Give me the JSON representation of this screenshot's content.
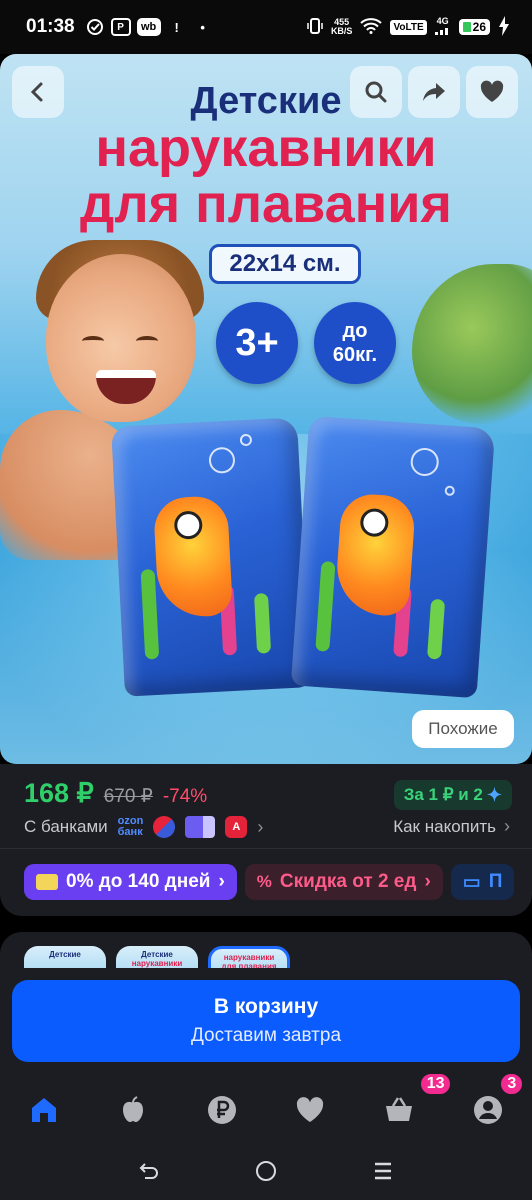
{
  "status_bar": {
    "time": "01:38",
    "net_speed_value": "455",
    "net_speed_unit": "KB/S",
    "volte": "VoLTE",
    "net_type": "4G",
    "battery": "26",
    "wb_label": "wb"
  },
  "hero": {
    "title_line1": "Детские",
    "title_line2": "нарукавники",
    "title_line3": "для плавания",
    "size_label": "22x14 см.",
    "age_badge": "3+",
    "weight_badge_line1": "до",
    "weight_badge_line2": "60кг.",
    "similar_label": "Похожие"
  },
  "price": {
    "current": "168 ₽",
    "old": "670 ₽",
    "discount": "-74%",
    "points": "За 1 ₽ и 2"
  },
  "banks": {
    "label": "С банками",
    "ozon_line1": "ozon",
    "ozon_line2": "банк",
    "accumulate_label": "Как накопить"
  },
  "promo_chips": [
    {
      "label": "0% до 140 дней"
    },
    {
      "label": "Скидка от 2 ед"
    },
    {
      "label": "П"
    }
  ],
  "gallery_thumb": {
    "line1": "Детские",
    "line2": "нарукавники",
    "line3": "для плавания"
  },
  "cart": {
    "title": "В корзину",
    "subtitle": "Доставим завтра"
  },
  "bottom_nav": {
    "cart_badge": "13",
    "profile_badge": "3"
  },
  "colors": {
    "accent_blue": "#0a5cff",
    "price_green": "#2fd06a",
    "discount_red": "#ff4d6b",
    "badge_pink": "#f32a8f"
  }
}
